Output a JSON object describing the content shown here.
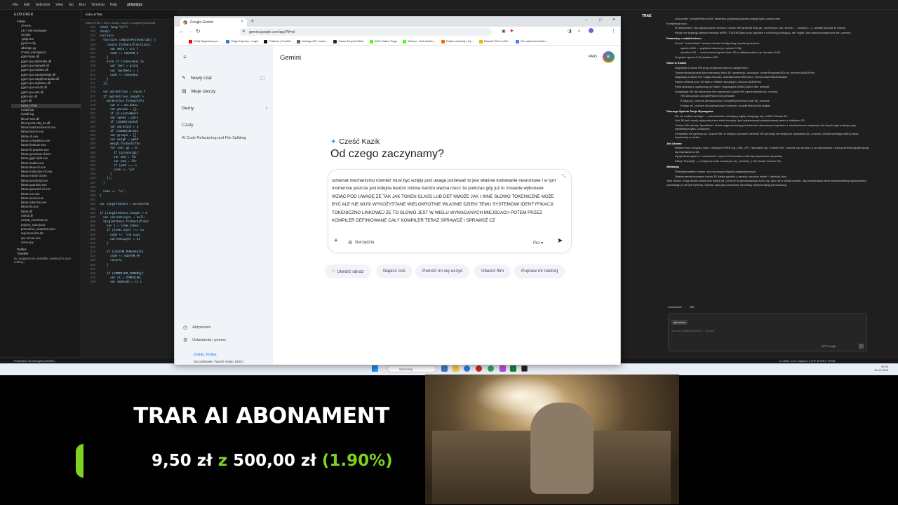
{
  "vscode": {
    "menu": [
      "File",
      "Edit",
      "Selection",
      "View",
      "Go",
      "Run",
      "Terminal",
      "Help"
    ],
    "window_label": "ghfghjfghj",
    "explorer_header": "Explorer",
    "folder_label": "Folder",
    "files": [
      "2l-venv",
      "Lib \\ site-packages",
      "Scripts",
      ".gitignore",
      "pyvenv.cfg",
      "albridge.py",
      "chunk_manager.js",
      "ggml-base.dll",
      "ggml-cpu-alderlake.dll",
      "ggml-cpu-haswell.dll",
      "ggml-cpu-icelake.dll",
      "ggml-cpu-sandybridge.dll",
      "ggml-cpu-sapphirerapids.dll",
      "ggml-cpu-skylakex.dll",
      "ggml-cpu-sse42.dll",
      "ggml-cpu-x64.dll",
      "ggml-rpc.dll",
      "ggml.dll",
      "index.HTML",
      "install.bat",
      "install.log",
      "libcurl-x64.dll",
      "libomp140.x86_64.dll",
      "llama-batched-bench.exe",
      "llama-bench.exe",
      "llama-cli.exe",
      "llama-completion.exe",
      "llama-finetune.exe",
      "llama-fit-params.exe",
      "llama-gemma3-cli.exe",
      "llama-gguf-split.exe",
      "llama-imatrix.exe",
      "llama-llava-cli.exe",
      "llama-minicpmv-cli.exe",
      "llama-mtmd-cli.exe",
      "llama-perplexity.exe",
      "llama-quantize.exe",
      "llama-qwen2vl-cli.exe",
      "llama-run.exe",
      "llama-server.exe",
      "llama-tokenize.exe",
      "llama-tts.exe",
      "llama.dll",
      "mtmd.dll",
      "neural_extension.js",
      "project_scan.json",
      "protection_snapshot.json",
      "requirements.txt",
      "rpc-server.exe",
      "server.py"
    ],
    "outline": "Outline",
    "timeline": "Timeline",
    "problems_note": "No suggestions available, waiting for your coding...",
    "tab": "index.HTML",
    "breadcrumb": "index.HTML > html > body > script > compilePythonGrid",
    "code_lines": [
      {
        "n": "261",
        "t": "<html lang=\"pl\">"
      },
      {
        "n": "262",
        "t": "<body>"
      },
      {
        "n": "263",
        "t": "<script>"
      },
      {
        "n": "264",
        "t": "  function compilePythonGrid() {"
      },
      {
        "n": "265",
        "t": "    chains.forEach(function(c"
      },
      {
        "n": "266",
        "t": "      var meta = src ?"
      },
      {
        "n": "267",
        "t": "      code += CUSTOM_P"
      },
      {
        "n": "268",
        "t": "    }"
      },
      {
        "n": "269",
        "t": "    else if (tokensOut.le"
      },
      {
        "n": "270",
        "t": "      var last = print"
      },
      {
        "n": "271",
        "t": "      var lastMeta = l"
      },
      {
        "n": "272",
        "t": "      code += tokenOut"
      },
      {
        "n": "273",
        "t": "    }"
      },
      {
        "n": "274",
        "t": "  });"
      },
      {
        "n": "275",
        "t": ""
      },
      {
        "n": "276",
        "t": "  var wirEntries = chain.f"
      },
      {
        "n": "277",
        "t": "  if (wirEntries.length >"
      },
      {
        "n": "278",
        "t": "    wirEntries.forEach(fu"
      },
      {
        "n": "279",
        "t": "      var d = ws.data;"
      },
      {
        "n": "280",
        "t": "      var params = {};"
      },
      {
        "n": "281",
        "t": "      if (d.customWire"
      },
      {
        "n": "282",
        "t": "      var speed = pars"
      },
      {
        "n": "283",
        "t": "      if (isNaN(speed)"
      },
      {
        "n": "284",
        "t": "      var duration = p"
      },
      {
        "n": "285",
        "t": "      if (isNaN(durati"
      },
      {
        "n": "286",
        "t": "      var groups = []"
      },
      {
        "n": "287",
        "t": "      var weigh = getD"
      },
      {
        "n": "288",
        "t": "      weigh.forEach(fun"
      },
      {
        "n": "289",
        "t": "      for (var gi = 0;"
      },
      {
        "n": "290",
        "t": "        if (groups[gi]"
      },
      {
        "n": "291",
        "t": "        var wId = fir"
      },
      {
        "n": "292",
        "t": "        var bId = fir"
      },
      {
        "n": "293",
        "t": "        if (wId === n"
      },
      {
        "n": "294",
        "t": "        code += 'wir"
      },
      {
        "n": "295",
        "t": "      }"
      },
      {
        "n": "296",
        "t": "    });"
      },
      {
        "n": "297",
        "t": "  }"
      },
      {
        "n": "298",
        "t": ""
      },
      {
        "n": "299",
        "t": "  code += '\\n';"
      },
      {
        "n": "300",
        "t": "}"
      },
      {
        "n": "301",
        "t": ""
      },
      {
        "n": "302",
        "t": "var singleTokens = activeTok"
      },
      {
        "n": "303",
        "t": ""
      },
      {
        "n": "304",
        "t": "if (singleTokens.length > 0"
      },
      {
        "n": "305",
        "t": "  var currentLayer = null;"
      },
      {
        "n": "306",
        "t": "  singleTokens.forEach(funct"
      },
      {
        "n": "307",
        "t": "    var t = item.token;"
      },
      {
        "n": "308",
        "t": "    if (item.layer !== cu"
      },
      {
        "n": "309",
        "t": "      code += '\\n# Layo"
      },
      {
        "n": "310",
        "t": "      currentLayer = it"
      },
      {
        "n": "311",
        "t": "    }"
      },
      {
        "n": "312",
        "t": ""
      },
      {
        "n": "313",
        "t": "    if (CUSTOM_PHRASES[t]"
      },
      {
        "n": "314",
        "t": "      code += CUSTOM_PH"
      },
      {
        "n": "315",
        "t": "      return;"
      },
      {
        "n": "316",
        "t": "    }"
      },
      {
        "n": "317",
        "t": ""
      },
      {
        "n": "318",
        "t": "    if (COMPILER_TOKENS[t"
      },
      {
        "n": "319",
        "t": "      var ct = COMPILER_"
      },
      {
        "n": "320",
        "t": "      var cmdCode = ct.c"
      }
    ],
    "status_left": "Protected: 0/0 changed (NOVEL)",
    "status_right": "Ln 2666, Col 1   Spaces: 4   UTF-8   CRLF   HTML"
  },
  "chat_panel": {
    "title": "TRAE",
    "lines": [
      {
        "k": "b",
        "t": "Linia prefix \"compilePythonGrid\" stwierdza poprawną ścieżkę obsługi trybu custom wire."
      },
      {
        "k": "n",
        "t": "Kompilacja kodu:"
      },
      {
        "k": "b",
        "t": "W łańcuchach i dla pojedynczych tokenów Custom Wir generuje linię wir_connect(src, dst, speed=..., duration=...), zamiast wycinać te tokeny."
      },
      {
        "k": "b",
        "t": "Wciąż nie wypisuję samych literałów WIRE_TOKENS jako kodu (zgodnie z ich funkcją linkującą, ale \"logika\" jest odwzorowana przez wir_connect."
      },
      {
        "k": "h",
        "t": "Parametry z notatki tokenu"
      },
      {
        "k": "b",
        "t": "W polu \"customNote\" możesz ustawić konfigurację impulsu przewodu:"
      },
      {
        "k": "b2",
        "t": "speed=NUM — prędkość obrotu (np. speed=0.03),"
      },
      {
        "k": "b2",
        "t": "duration=MS — czas trwania impulsu linku 3D w milisekundach (np. duration=240)."
      },
      {
        "k": "b",
        "t": "Przykład: speed=0.02;duration=200"
      },
      {
        "k": "h",
        "t": "Gdzie w Kodzie"
      },
      {
        "k": "b",
        "t": "Aktywacja Custom Wir przy przypisaniu tokenu: assignToken"
      },
      {
        "k": "b",
        "t": "Tworzenie/utrzymanie tymczasowego linku 3D, rejestracja i usunięcie: createTemporary3DLink, removeLink3DEntry"
      },
      {
        "k": "b",
        "t": "Aktywacja Custom Wir i logika impulsu: activateCustomWirToken, checkCustomWirActivation"
      },
      {
        "k": "b",
        "t": "Rejestr definicji linku 3D tylko z efektem wizualnym: ensureLink3DEntry"
      },
      {
        "k": "b",
        "t": "Pętla animacji z prędkością per token i regulacjami ANW/Custom Wir: animate"
      },
      {
        "k": "b",
        "t": "Kompilacja: filtr dla łańcuchów bez wycinania Custom Wir i generowanie wir_connect:"
      },
      {
        "k": "b2",
        "t": "Filtr łańcuchów: compilePythonGrid printable"
      },
      {
        "k": "b2",
        "t": "Emisja wir_connect dla łańcuchów: compilePythonGrid chain wir_connect"
      },
      {
        "k": "b2",
        "t": "Emisja wir_connect dla pojedynczych tokenów: compilePythonGrid singles"
      },
      {
        "k": "h",
        "t": "Dlaczego Spełnia Twoje Wymagania"
      },
      {
        "k": "b",
        "t": "Nic nie zostało usunięte — rozbudowałem istniejącą logikę, integrując się z ANW i linkami 3D."
      },
      {
        "k": "b",
        "t": "Link 3D jest umarły wyłącznie przez efekt wizualny i jest rejestrowany/odrejestrowany razem z obiektem 3D."
      },
      {
        "k": "b",
        "t": "Custom Wir stał się \"łącznikiem\" dwóch najprzechodzących tokenów: sterowanym impulsem z mechanizmem wspólnym dla innych logik (rotacja, pętę wymieniana tylko, cooldown)."
      },
      {
        "k": "b",
        "t": "Kompilator nie wyrzuca już Custom Wir; w miejscu surowych tokenów Wir generuje semantyczne wywołania wir_connect, odzwierciedlając realną pracę impulsowej w kodzie."
      },
      {
        "k": "h",
        "t": "Jak Używać"
      },
      {
        "k": "b",
        "t": "Wybierz has i przypisz token z kategorii WIRE (np. LINK_UP). Has stanie się \"Custom Wir\", zacznie się obracać, a po wyrównaniu z parą przedniej będzie łączył się impulsowo w 3D."
      },
      {
        "k": "b",
        "t": "Opcjonalnie wpisz w \"customNote\": speed=0.03;duration=240 aby dopasować dynamikę."
      },
      {
        "k": "b",
        "t": "Kliknij \"Kompiluj\" — w edytorze kodu zobaczysz wir_connect(...) dla Twoich Custom Wir."
      },
      {
        "k": "h",
        "t": "Walidacja"
      },
      {
        "k": "b",
        "t": "Przeskanowałem zmiany i nie ma nowych błędów diagnostycznych."
      },
      {
        "k": "b",
        "t": "Rejestrowanie/usuwanie linków 3D działa zgodnie z zasadą: wizualny obiekt = definicja linku."
      },
      {
        "k": "n",
        "t": "Jeśli chcesz, mogę dodać prosty stub funkcji wir_connect do generowanego kodu (np. jako util w sekcji header), aby kompilowany tekst miał kompletną wykonywalną semantykę po stronie Pythona. Możesz stub jako komentarz lub krótką implementację pomocniczą?"
      }
    ],
    "completed": "Completed",
    "diff": "Diff",
    "input_tag": "@context",
    "input_placeholder": "You are chatting with Bi — 33 New",
    "model": "GPT-5-high"
  },
  "taskbar": {
    "search_placeholder": "Wyszukaj",
    "time": "09:33",
    "date": "10.02.2026"
  },
  "browser": {
    "tab_title": "Google Gemini",
    "url": "gemini.google.com/app?hl=pl",
    "bookmarks": [
      "(248) Najnowsze pr...",
      "Unigo Express - Login",
      "Platform | ChatGo",
      "interhyp API i calcu...",
      "Game Empire Editor",
      "KICK Status Page",
      "Stream - Kick Dashb...",
      "Edytor animacji | Gy...",
      "Deposit PLN on Bri...",
      "File upload & sharin..."
    ]
  },
  "gemini": {
    "app_name": "Gemini",
    "pro_badge": "PRO",
    "avatar_letter": "K",
    "new_chat": "Nowy czat",
    "my_items": "Moje rzeczy",
    "gems": "Gemy",
    "chats_header": "Czaty",
    "chat_item": "AI Code Refactoring and File Splitting",
    "activity": "Aktywność",
    "settings": "Ustawienia i pomoc",
    "location": "Drobin, Polska",
    "location_sub": "Na podstawie Twoich miejsc (dom)",
    "greeting": "Cześć Kazik",
    "heading": "Od czego zaczynamy?",
    "prompt_text": "schemat mechanizmu również musi być wzięty pod uwagę ponieważ to jest właśnie kodowanie neuronowe I w tym momencie jeszcze jest kolejna bardzo istotna bardzo ważna rzecz że podczas gdy już to zostanie wykonane WZIĄĆ POD UWAGĘ ŻE TAK JAK TOKEN CLASS LUB DEF NMOŻE JAK I INNE SŁOWO TOKENICZNE MOŻE BYĆ ALE NIE MUSI WYKOŻYSTANE WIELOKROTNIE WŁASNIE DZIEKI TEMU SYSTEMOWI IDENTYFIKACJI TOKENICZNO LINKOWEJ ZE TO SŁOWO JEST W WIELU WYMAGANYCH MIEJSCACH POTEM PRZEZ KOMPILER DEFINIOWANE CAŁY KOMPILER TERAZ SPRAWDŹ I SPRAWDŹ CZ",
    "tools": "Narzędzia",
    "model": "Pro",
    "chips": [
      "Utwórz obraz",
      "Napisz coś",
      "Pomóż mi się uczyć",
      "Utwórz film",
      "Popraw mi nastrój"
    ]
  },
  "banner": {
    "title": "TRAR AI ABONAMENT",
    "amount": "9,50 zł",
    "connector": "z",
    "goal": "500,00 zł",
    "percent": "(1.90%)",
    "progress_fraction": 0.019,
    "green": "#7fd220"
  }
}
